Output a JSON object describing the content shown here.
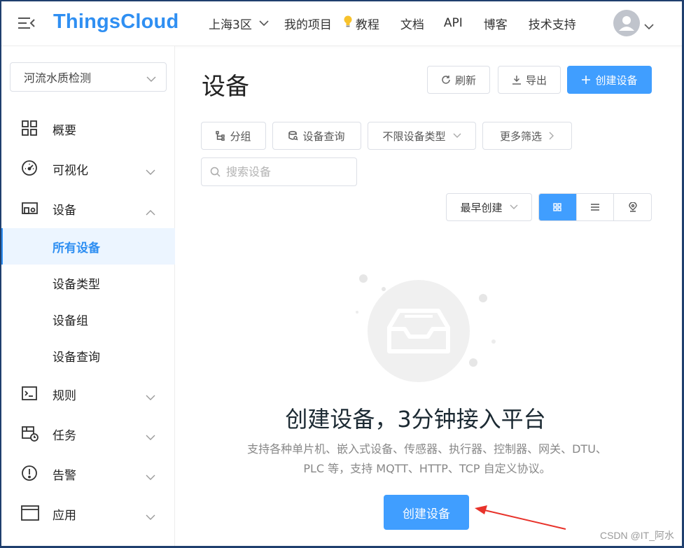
{
  "header": {
    "logo": "ThingsCloud",
    "nav": {
      "region": "上海3区",
      "projects": "我的项目",
      "tutorial": "教程",
      "docs": "文档",
      "api": "API",
      "blog": "博客",
      "support": "技术支持"
    }
  },
  "sidebar": {
    "project_select": "河流水质检测",
    "items": {
      "overview": "概要",
      "visualize": "可视化",
      "devices": "设备",
      "all_devices": "所有设备",
      "device_types": "设备类型",
      "device_groups": "设备组",
      "device_query": "设备查询",
      "rules": "规则",
      "tasks": "任务",
      "alerts": "告警",
      "apps": "应用"
    },
    "active_item": "所有设备"
  },
  "main": {
    "title": "设备",
    "actions": {
      "refresh": "刷新",
      "export": "导出",
      "create": "创建设备"
    },
    "filters": {
      "group": "分组",
      "query": "设备查询",
      "type": "不限设备类型",
      "more": "更多筛选"
    },
    "search": {
      "placeholder": "搜索设备",
      "value": ""
    },
    "sort": "最早创建",
    "view_modes": [
      "grid",
      "list",
      "map"
    ],
    "active_view": "grid",
    "empty": {
      "title": "创建设备，3分钟接入平台",
      "desc_line1": "支持各种单片机、嵌入式设备、传感器、执行器、控制器、网关、DTU、",
      "desc_line2": "PLC 等，支持 MQTT、HTTP、TCP 自定义协议。",
      "cta": "创建设备"
    }
  },
  "watermark": "CSDN @IT_阿水",
  "colors": {
    "brand": "#2f8ff2",
    "primary": "#409eff",
    "active_bg": "#ecf5ff",
    "annotation": "#e8322a"
  }
}
